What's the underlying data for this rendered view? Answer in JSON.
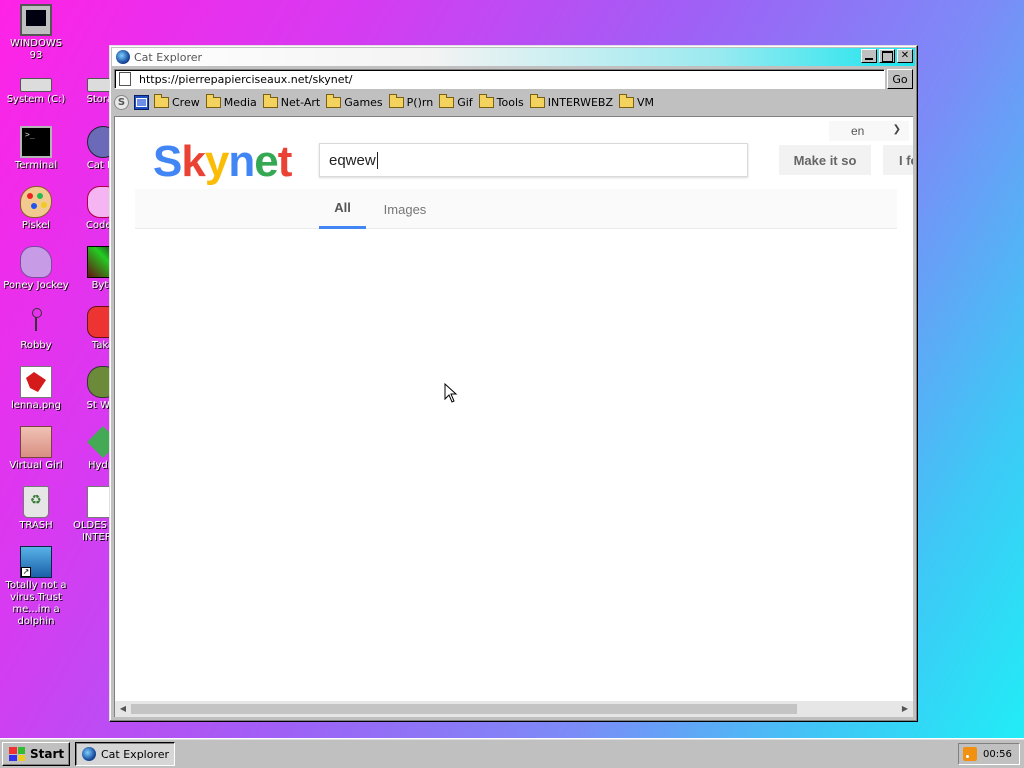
{
  "desktop": {
    "icons": [
      {
        "label": "WINDOWS 93",
        "icon": "monitor-icon"
      },
      {
        "label": "System (C:)",
        "icon": "drive-icon"
      },
      {
        "label": "Terminal",
        "icon": "terminal-icon"
      },
      {
        "label": "Piskel",
        "icon": "palette-icon"
      },
      {
        "label": "Poney Jockey",
        "icon": "pony-icon"
      },
      {
        "label": "Robby",
        "icon": "stick-figure-icon"
      },
      {
        "label": "lenna.png",
        "icon": "image-file-icon"
      },
      {
        "label": "Virtual Girl",
        "icon": "girl-icon"
      },
      {
        "label": "TRASH",
        "icon": "recycle-bin-icon"
      },
      {
        "label": "Totally not a virus.Trust me...im a dolphin",
        "icon": "dolphin-icon"
      }
    ],
    "icons_col2": [
      {
        "label": "Storag",
        "icon": "drive-icon"
      },
      {
        "label": "Cat Ex",
        "icon": "globe-icon"
      },
      {
        "label": "CodeM",
        "icon": "cat-icon"
      },
      {
        "label": "Byte",
        "icon": "app-icon"
      },
      {
        "label": "Take",
        "icon": "game-icon"
      },
      {
        "label": "St War",
        "icon": "yoda-icon"
      },
      {
        "label": "Hydra",
        "icon": "hydra-icon"
      },
      {
        "label": "OLDES OF T INTER gi",
        "icon": "image-file-icon"
      }
    ]
  },
  "window": {
    "title": "Cat Explorer",
    "url": "https://pierrepapierciseaux.net/skynet/",
    "go_label": "Go",
    "bookmarks": [
      "Crew",
      "Media",
      "Net-Art",
      "Games",
      "P()rn",
      "Gif",
      "Tools",
      "INTERWEBZ",
      "VM"
    ]
  },
  "page": {
    "lang": "en",
    "logo_letters": [
      "S",
      "k",
      "y",
      "n",
      "e",
      "t"
    ],
    "search_value": "eqwew",
    "make_it_so": "Make it so",
    "lucky": "I fe",
    "tabs": [
      "All",
      "Images"
    ],
    "colors": {
      "blue": "#4285f4",
      "red": "#ea4335",
      "yellow": "#fbbc05",
      "green": "#34a853"
    }
  },
  "taskbar": {
    "start_label": "Start",
    "task_label": "Cat Explorer",
    "clock": "00:56"
  }
}
